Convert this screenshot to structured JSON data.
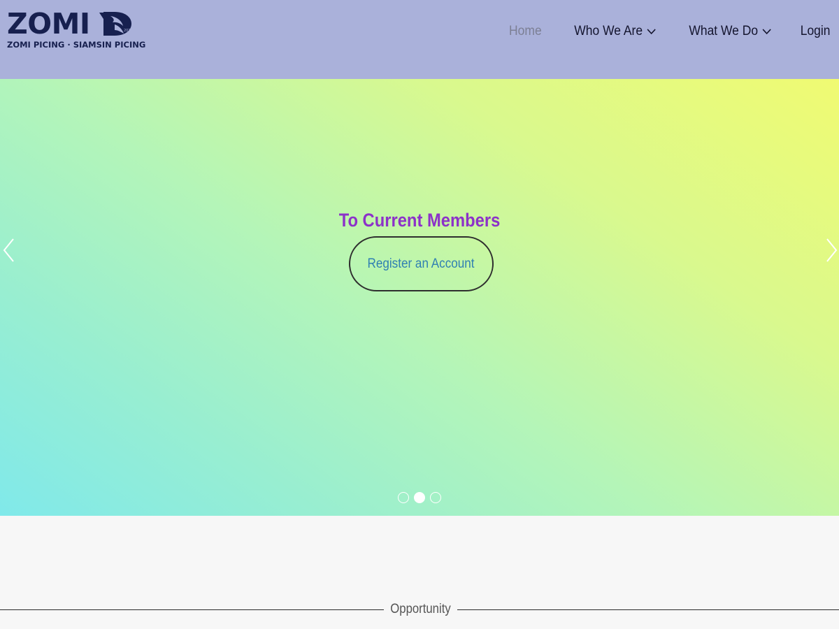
{
  "header": {
    "logo": {
      "word": "ZOMI YD",
      "word_visible": "ZOMI Y",
      "tagline": "ZOMI PICING · SIAMSIN PICING",
      "mark_icon": "bird-d-logo-icon"
    },
    "nav": [
      {
        "label": "Home",
        "active": true,
        "dropdown": false
      },
      {
        "label": "Who We Are",
        "active": false,
        "dropdown": true
      },
      {
        "label": "What We Do",
        "active": false,
        "dropdown": true
      },
      {
        "label": "Login",
        "active": false,
        "dropdown": false
      }
    ],
    "background": "#aab1da"
  },
  "hero": {
    "title": "To Current Members",
    "button_label": "Register an Account",
    "prev_icon": "chevron-left-icon",
    "next_icon": "chevron-right-icon",
    "slides_total": 3,
    "active_slide": 2,
    "colors": {
      "title": "#8c31c9",
      "button_text": "#2f7fb2",
      "gradient_start": "#80e9ea",
      "gradient_end": "#f0fa72"
    }
  },
  "section": {
    "divider_label": "Opportunity"
  }
}
